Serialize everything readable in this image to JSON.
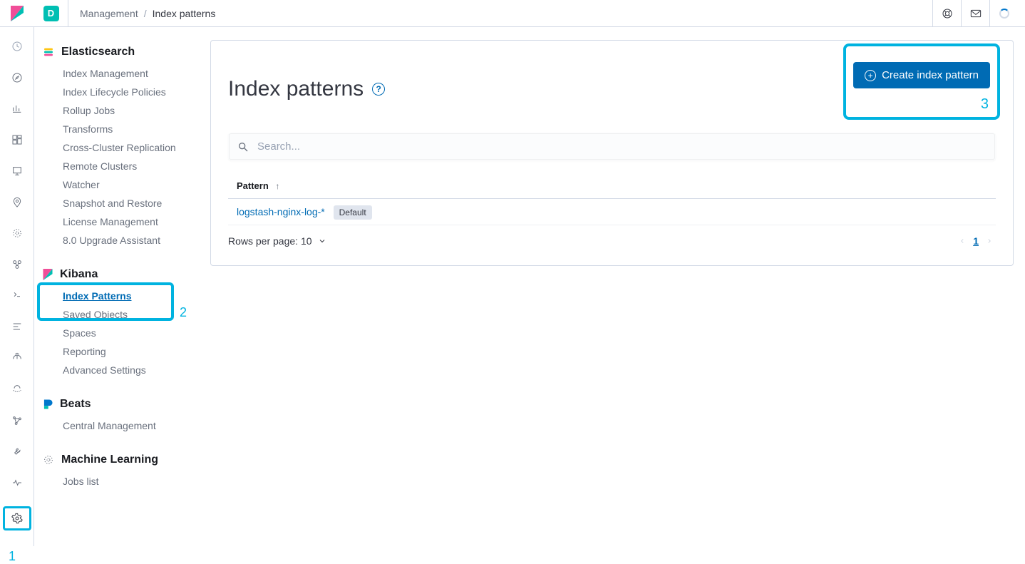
{
  "header": {
    "space_letter": "D",
    "breadcrumb_parent": "Management",
    "breadcrumb_current": "Index patterns"
  },
  "iconbar_items": [
    "recent-icon",
    "discover-icon",
    "visualize-icon",
    "dashboard-icon",
    "canvas-icon",
    "maps-icon",
    "ml-icon",
    "infrastructure-icon",
    "logs-icon",
    "apm-icon",
    "uptime-icon",
    "siem-icon",
    "graph-icon",
    "devtools-icon",
    "monitoring-icon",
    "management-icon"
  ],
  "callouts": {
    "one": "1",
    "two": "2",
    "three": "3"
  },
  "sidebar": {
    "elasticsearch": {
      "title": "Elasticsearch",
      "items": [
        "Index Management",
        "Index Lifecycle Policies",
        "Rollup Jobs",
        "Transforms",
        "Cross-Cluster Replication",
        "Remote Clusters",
        "Watcher",
        "Snapshot and Restore",
        "License Management",
        "8.0 Upgrade Assistant"
      ]
    },
    "kibana": {
      "title": "Kibana",
      "items": [
        "Index Patterns",
        "Saved Objects",
        "Spaces",
        "Reporting",
        "Advanced Settings"
      ],
      "active_index": 0
    },
    "beats": {
      "title": "Beats",
      "items": [
        "Central Management"
      ]
    },
    "ml": {
      "title": "Machine Learning",
      "items": [
        "Jobs list"
      ]
    }
  },
  "main": {
    "title": "Index patterns",
    "create_label": "Create index pattern",
    "search_placeholder": "Search...",
    "table": {
      "col_header": "Pattern",
      "rows": [
        {
          "name": "logstash-nginx-log-*",
          "default_badge": "Default"
        }
      ]
    },
    "footer": {
      "rpp_label": "Rows per page: 10",
      "current_page": "1"
    }
  }
}
